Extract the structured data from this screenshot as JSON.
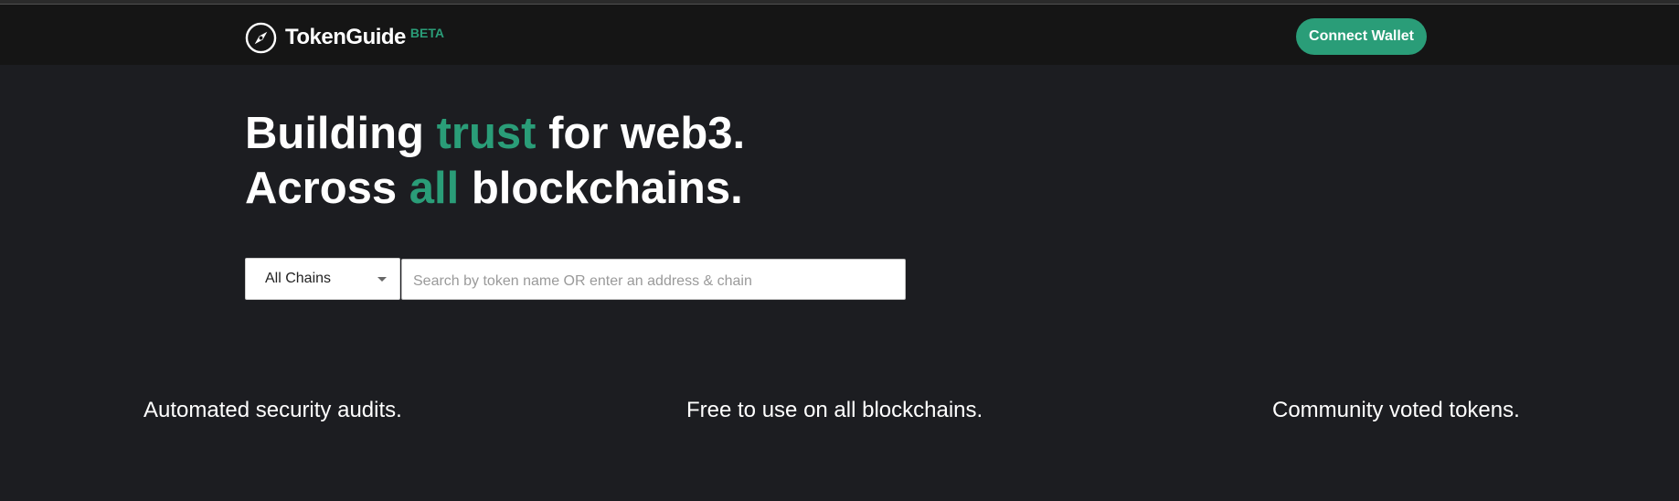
{
  "header": {
    "brand": "TokenGuide",
    "badge": "BETA",
    "connect_label": "Connect Wallet",
    "logo_icon": "compass-icon"
  },
  "hero": {
    "line1": {
      "pre": "Building ",
      "accent": "trust",
      "post": " for web3."
    },
    "line2": {
      "pre": "Across ",
      "accent": "all",
      "post": " blockchains."
    }
  },
  "search": {
    "chain_selected": "All Chains",
    "value": "",
    "placeholder": "Search by token name OR enter an address & chain"
  },
  "features": [
    "Automated security audits.",
    "Free to use on all blockchains.",
    "Community voted tokens."
  ],
  "colors": {
    "accent": "#2a9d78",
    "background": "#1c1d21",
    "navbar": "#151515"
  }
}
